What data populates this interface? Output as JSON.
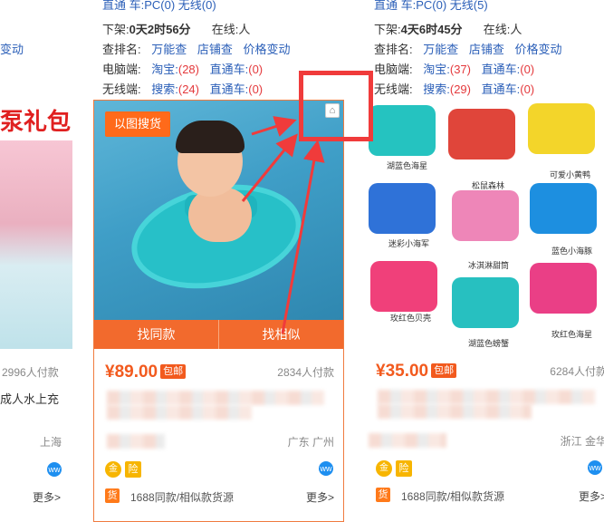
{
  "left_column": {
    "line_partial": "变动",
    "banner_text": "泵礼包",
    "pay_count": "2996人付款",
    "title_partial": "成人水上充",
    "location": "上海",
    "more": "更多>"
  },
  "middle_card": {
    "top_line": "直通 车:PC(0) 无线(0)",
    "listed_label": "下架:",
    "listed_value": "0天2时56分",
    "online_label": "在线:",
    "online_value": "人",
    "rank_label": "查排名:",
    "rank_links": [
      "万能查",
      "店铺查",
      "价格变动"
    ],
    "pc_label": "电脑端:",
    "pc_taobao_label": "淘宝:",
    "pc_taobao_value": "(28)",
    "pc_ztc_label": "直通车:",
    "pc_ztc_value": "(0)",
    "wireless_label": "无线端:",
    "wireless_search_label": "搜索:",
    "wireless_search_value": "(24)",
    "wireless_ztc_label": "直通车:",
    "wireless_ztc_value": "(0)",
    "search_by_image": "以图搜货",
    "find_same": "找同款",
    "find_similar": "找相似",
    "price": "¥89.00",
    "free_shipping": "包邮",
    "pay_count": "2834人付款",
    "location": "广东 广州",
    "insure_label": "险",
    "gold_label": "金",
    "source_badge": "货",
    "source_text": "1688同款/相似款货源",
    "more": "更多>"
  },
  "right_card": {
    "top_line": "直通 车:PC(0) 无线(5)",
    "listed_label": "下架:",
    "listed_value": "4天6时45分",
    "online_label": "在线:",
    "online_value": "人",
    "rank_label": "查排名:",
    "rank_links": [
      "万能查",
      "店铺查",
      "价格变动"
    ],
    "pc_label": "电脑端:",
    "pc_taobao_label": "淘宝:",
    "pc_taobao_value": "(37)",
    "pc_ztc_label": "直通车:",
    "pc_ztc_value": "(0)",
    "wireless_label": "无线端:",
    "wireless_search_label": "搜索:",
    "wireless_search_value": "(29)",
    "wireless_ztc_label": "直通车:",
    "wireless_ztc_value": "(0)",
    "floatie_labels": [
      "湖蓝色海星",
      "松鼠森林",
      "可爱小黄鸭",
      "迷彩小海军",
      "冰淇淋甜筒",
      "蓝色小海豚",
      "玫红色贝壳",
      "湖蓝色螃蟹",
      "玫红色海星"
    ],
    "price": "¥35.00",
    "free_shipping": "包邮",
    "pay_count": "6284人付款",
    "location": "浙江 金华",
    "insure_label": "险",
    "gold_label": "金",
    "source_badge": "货",
    "source_text": "1688同款/相似款货源",
    "more": "更多>"
  },
  "colors": {
    "accent_orange": "#f26a2d",
    "price_orange": "#f25a1e",
    "link_blue": "#2b5fb8",
    "annotation_red": "#f03b3b"
  }
}
